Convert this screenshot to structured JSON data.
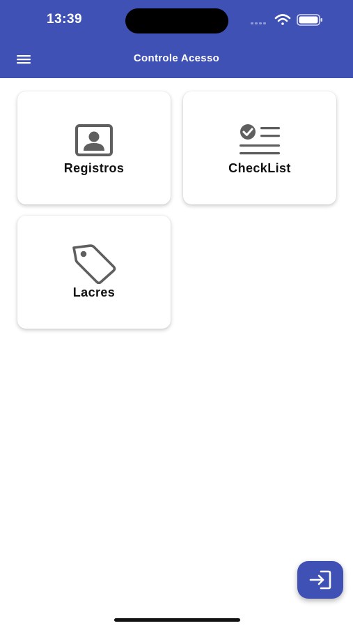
{
  "status_bar": {
    "time": "13:39",
    "icons": [
      "signal-icon",
      "wifi-icon",
      "battery-icon"
    ]
  },
  "app_bar": {
    "title": "Controle Acesso",
    "menu_icon": "hamburger-menu-icon",
    "background_color": "#3f51b5"
  },
  "tiles": [
    {
      "label": "Registros",
      "icon": "contact-card-icon"
    },
    {
      "label": "CheckList",
      "icon": "checklist-icon"
    },
    {
      "label": "Lacres",
      "icon": "tag-icon"
    }
  ],
  "fab": {
    "icon": "login-icon",
    "color": "#3f51b5"
  },
  "colors": {
    "accent": "#3f51b5",
    "icon_gray": "#5f5f5f"
  }
}
